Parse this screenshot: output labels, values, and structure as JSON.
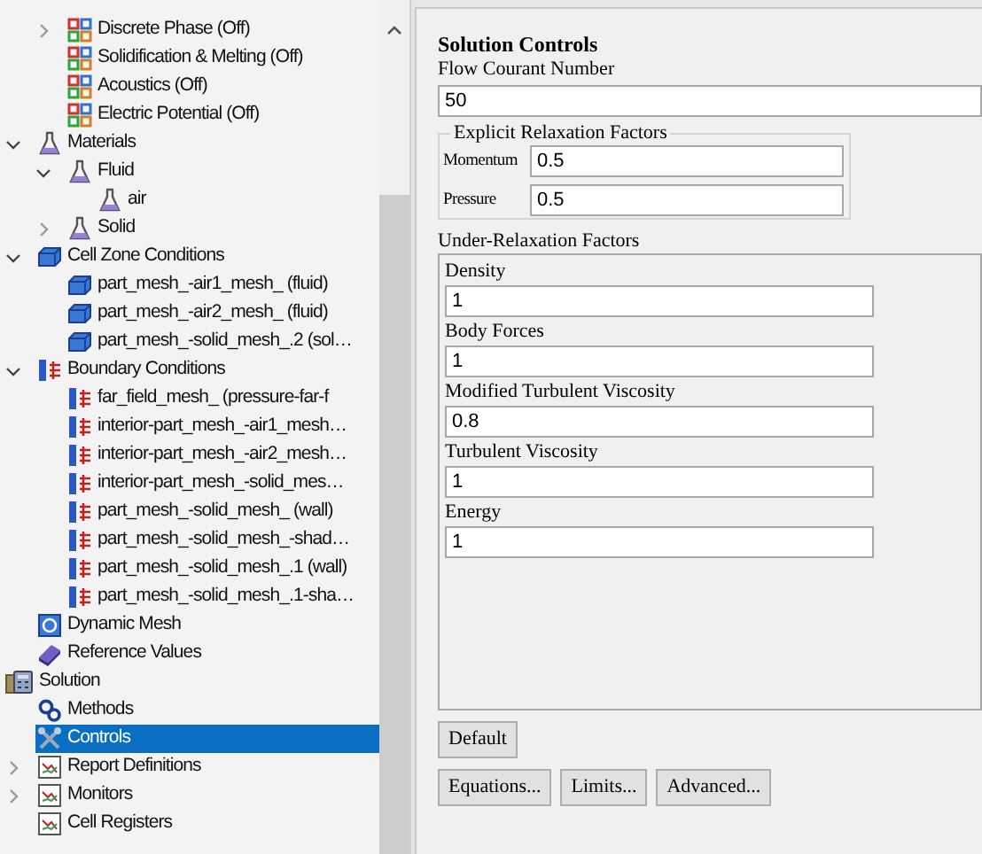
{
  "tree": [
    {
      "children": [
        {
          "children": [
            {
              "label": "Discrete Phase (Off)",
              "kind": "model",
              "expanded": false,
              "selected": false
            },
            {
              "label": "Solidification & Melting (Off)",
              "kind": "model",
              "selected": false
            },
            {
              "label": "Acoustics (Off)",
              "kind": "model",
              "selected": false
            },
            {
              "label": "Electric Potential (Off)",
              "kind": "model",
              "selected": false
            }
          ]
        },
        {
          "label": "Materials",
          "kind": "flask",
          "expanded": true,
          "selected": false,
          "children": [
            {
              "label": "Fluid",
              "kind": "flask",
              "expanded": true,
              "selected": false,
              "children": [
                {
                  "label": "air",
                  "kind": "flask",
                  "selected": false
                }
              ]
            },
            {
              "label": "Solid",
              "kind": "flask",
              "expanded": false,
              "selected": false
            }
          ]
        },
        {
          "label": "Cell Zone Conditions",
          "kind": "zone",
          "expanded": true,
          "selected": false,
          "children": [
            {
              "label": "part_mesh_-air1_mesh_ (fluid)",
              "kind": "zone",
              "selected": false
            },
            {
              "label": "part_mesh_-air2_mesh_ (fluid)",
              "kind": "zone",
              "selected": false
            },
            {
              "label": "part_mesh_-solid_mesh_.2 (sol…",
              "kind": "zone",
              "selected": false
            }
          ]
        },
        {
          "label": "Boundary Conditions",
          "kind": "boundary",
          "expanded": true,
          "selected": false,
          "children": [
            {
              "label": "far_field_mesh_ (pressure-far-f",
              "kind": "boundary",
              "selected": false
            },
            {
              "label": "interior-part_mesh_-air1_mesh…",
              "kind": "boundary",
              "selected": false
            },
            {
              "label": "interior-part_mesh_-air2_mesh…",
              "kind": "boundary",
              "selected": false
            },
            {
              "label": "interior-part_mesh_-solid_mes…",
              "kind": "boundary",
              "selected": false
            },
            {
              "label": "part_mesh_-solid_mesh_ (wall)",
              "kind": "boundary",
              "selected": false
            },
            {
              "label": "part_mesh_-solid_mesh_-shad…",
              "kind": "boundary",
              "selected": false
            },
            {
              "label": "part_mesh_-solid_mesh_.1 (wall)",
              "kind": "boundary",
              "selected": false
            },
            {
              "label": "part_mesh_-solid_mesh_.1-sha…",
              "kind": "boundary",
              "selected": false
            }
          ]
        },
        {
          "label": "Dynamic Mesh",
          "kind": "mesh",
          "selected": false
        },
        {
          "label": "Reference Values",
          "kind": "book",
          "selected": false
        }
      ]
    },
    {
      "label": "Solution",
      "kind": "solution",
      "selected": false,
      "children": [
        {
          "label": "Methods",
          "kind": "gears",
          "selected": false
        },
        {
          "label": "Controls",
          "kind": "tools",
          "selected": true
        },
        {
          "label": "Report Definitions",
          "kind": "chart",
          "expanded": false,
          "selected": false
        },
        {
          "label": "Monitors",
          "kind": "chart",
          "expanded": false,
          "selected": false
        },
        {
          "label": "Cell Registers",
          "kind": "chart",
          "selected": false
        }
      ]
    }
  ],
  "task_page": {
    "title": "Solution Controls",
    "courant": {
      "label": "Flow Courant Number",
      "value": "50"
    },
    "explicit": {
      "title": "Explicit Relaxation Factors",
      "fields": [
        {
          "label": "Momentum",
          "value": "0.5"
        },
        {
          "label": "Pressure",
          "value": "0.5"
        }
      ]
    },
    "under_relaxation": {
      "title": "Under-Relaxation Factors",
      "fields": [
        {
          "label": "Density",
          "value": "1"
        },
        {
          "label": "Body Forces",
          "value": "1"
        },
        {
          "label": "Modified Turbulent Viscosity",
          "value": "0.8"
        },
        {
          "label": "Turbulent Viscosity",
          "value": "1"
        },
        {
          "label": "Energy",
          "value": "1"
        }
      ]
    },
    "buttons": [
      [
        "Default"
      ],
      [
        "Equations...",
        "Limits...",
        "Advanced..."
      ]
    ]
  }
}
